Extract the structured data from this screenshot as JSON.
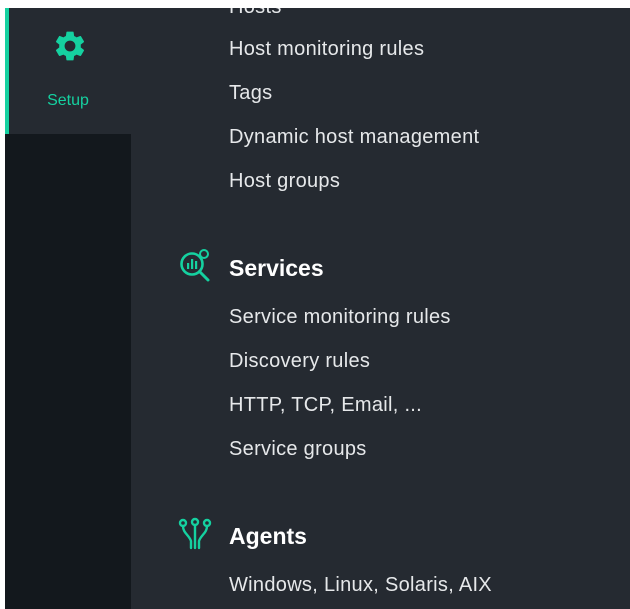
{
  "sidebar": {
    "setup_label": "Setup",
    "setup_icon": "gear-icon",
    "accent_color": "#15d1a0"
  },
  "hosts": {
    "items": [
      "Hosts",
      "Host monitoring rules",
      "Tags",
      "Dynamic host management",
      "Host groups"
    ]
  },
  "services": {
    "title": "Services",
    "icon": "service-search-icon",
    "items": [
      "Service monitoring rules",
      "Discovery rules",
      "HTTP, TCP, Email, ...",
      "Service groups"
    ]
  },
  "agents": {
    "title": "Agents",
    "icon": "agents-icon",
    "items": [
      "Windows, Linux, Solaris, AIX"
    ]
  }
}
